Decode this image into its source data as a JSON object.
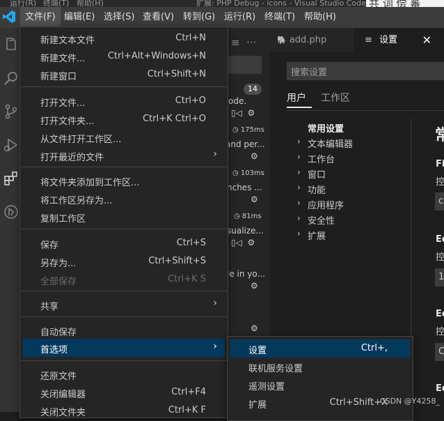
{
  "title_strip": {
    "left_items": [
      "运行(R)",
      "终端(T)",
      "帮助(H)"
    ],
    "window_title": "扩展: PHP Debug - icons - Visual Studio Code",
    "right_text": "共 词 偿 蕃"
  },
  "menubar": [
    "文件(F)",
    "编辑(E)",
    "选择(S)",
    "查看(V)",
    "转到(G)",
    "运行(R)",
    "终端(T)",
    "帮助(H)"
  ],
  "file_menu": {
    "items": [
      {
        "label": "新建文本文件",
        "key": "Ctrl+N"
      },
      {
        "label": "新建文件...",
        "key": "Ctrl+Alt+Windows+N"
      },
      {
        "label": "新建窗口",
        "key": "Ctrl+Shift+N"
      },
      {
        "label": "打开文件...",
        "key": "Ctrl+O"
      },
      {
        "label": "打开文件夹...",
        "key": "Ctrl+K Ctrl+O"
      },
      {
        "label": "从文件打开工作区...",
        "key": ""
      },
      {
        "label": "打开最近的文件",
        "key": ""
      },
      {
        "label": "将文件夹添加到工作区...",
        "key": ""
      },
      {
        "label": "将工作区另存为...",
        "key": ""
      },
      {
        "label": "复制工作区",
        "key": ""
      },
      {
        "label": "保存",
        "key": "Ctrl+S"
      },
      {
        "label": "另存为...",
        "key": "Ctrl+Shift+S"
      },
      {
        "label": "全部保存",
        "key": "Ctrl+K S"
      },
      {
        "label": "共享",
        "key": ""
      },
      {
        "label": "自动保存",
        "key": ""
      },
      {
        "label": "首选项",
        "key": ""
      },
      {
        "label": "还原文件",
        "key": ""
      },
      {
        "label": "关闭编辑器",
        "key": "Ctrl+F4"
      },
      {
        "label": "关闭文件夹",
        "key": "Ctrl+K F"
      }
    ]
  },
  "pref_submenu": {
    "items": [
      {
        "label": "设置",
        "key": "Ctrl+,"
      },
      {
        "label": "联机服务设置",
        "key": ""
      },
      {
        "label": "遥测设置",
        "key": ""
      },
      {
        "label": "扩展",
        "key": "Ctrl+Shift+X"
      }
    ]
  },
  "sidebar": {
    "badge": "14",
    "snippets": [
      "ode.",
      "and per...",
      "nches ...",
      "sualize...",
      "le in yo..."
    ],
    "timings": [
      "175ms",
      "103ms",
      "81ms"
    ]
  },
  "tabs": {
    "tab1": "add.php",
    "tab2": "设置"
  },
  "settings": {
    "search_placeholder": "搜索设置",
    "scope_user": "用户",
    "scope_workspace": "工作区",
    "common": "常用设置",
    "tree": [
      "文本编辑器",
      "工作台",
      "窗口",
      "功能",
      "应用程序",
      "安全性",
      "扩展"
    ],
    "right_header": "常",
    "right_labels": [
      "Fil",
      "控",
      "Ed",
      "控",
      "Ed",
      "控",
      "Ed"
    ],
    "right_values": [
      "c",
      "1",
      "C"
    ]
  },
  "watermark": "CSDN @Y4258_"
}
